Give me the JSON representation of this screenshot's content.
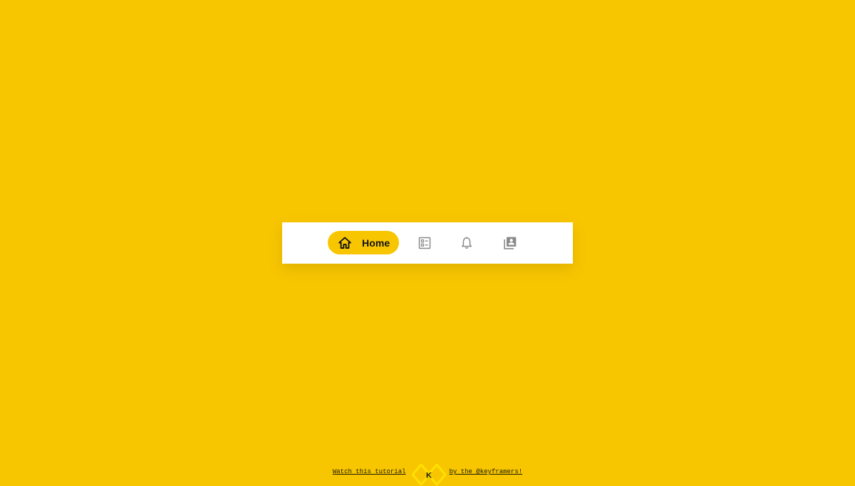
{
  "colors": {
    "background": "#F8C600",
    "bar_background": "#FFFFFF",
    "active_pill": "#F8C600",
    "inactive_icon": "#8A8A8A",
    "active_text": "#111111"
  },
  "nav": {
    "items": [
      {
        "icon": "home-icon",
        "label": "Home",
        "active": true
      },
      {
        "icon": "checklist-icon",
        "active": false
      },
      {
        "icon": "bell-icon",
        "active": false
      },
      {
        "icon": "library-contact-icon",
        "active": false
      }
    ]
  },
  "footer": {
    "tutorial_link": "Watch this tutorial",
    "logo_icon": "keyframers-logo-icon",
    "logo_letter": "K",
    "credit_link": "by the @keyframers!"
  }
}
